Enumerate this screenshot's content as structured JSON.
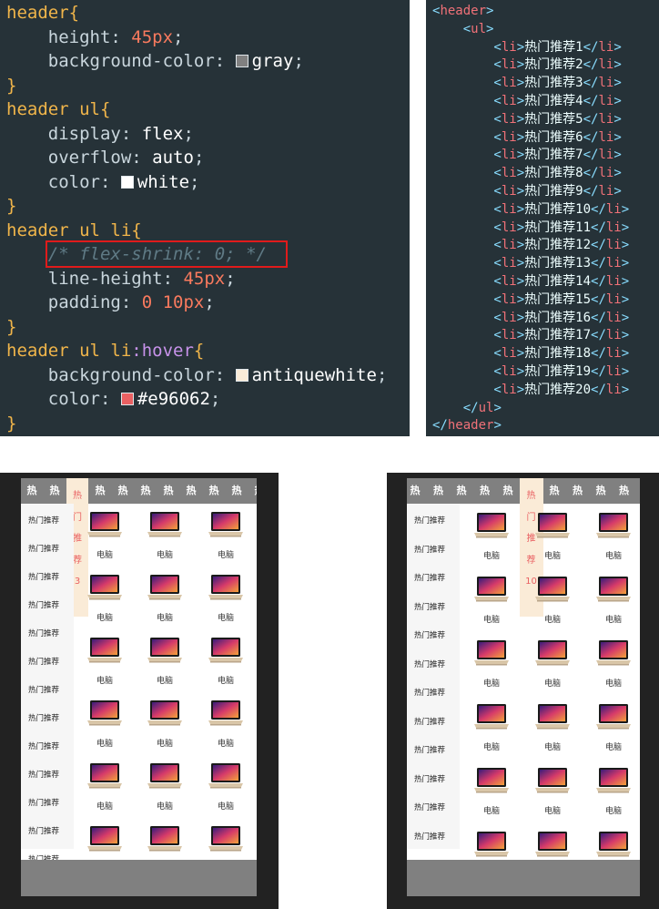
{
  "css_code": {
    "lines": [
      [
        {
          "t": "header",
          "c": "t-sel"
        },
        {
          "t": "{",
          "c": "t-brace"
        }
      ],
      [
        {
          "t": "    height",
          "c": "t-prop"
        },
        {
          "t": ": ",
          "c": "t-punc"
        },
        {
          "t": "45px",
          "c": "t-num"
        },
        {
          "t": ";",
          "c": "t-punc"
        }
      ],
      [
        {
          "t": "    background-color",
          "c": "t-prop"
        },
        {
          "t": ": ",
          "c": "t-punc"
        },
        {
          "sw": "#808080"
        },
        {
          "t": "gray",
          "c": "t-kw"
        },
        {
          "t": ";",
          "c": "t-punc"
        }
      ],
      [
        {
          "t": "}",
          "c": "t-brace"
        }
      ],
      [
        {
          "t": "header ul",
          "c": "t-sel"
        },
        {
          "t": "{",
          "c": "t-brace"
        }
      ],
      [
        {
          "t": "    display",
          "c": "t-prop"
        },
        {
          "t": ": ",
          "c": "t-punc"
        },
        {
          "t": "flex",
          "c": "t-kw"
        },
        {
          "t": ";",
          "c": "t-punc"
        }
      ],
      [
        {
          "t": "    overflow",
          "c": "t-prop"
        },
        {
          "t": ": ",
          "c": "t-punc"
        },
        {
          "t": "auto",
          "c": "t-kw"
        },
        {
          "t": ";",
          "c": "t-punc"
        }
      ],
      [
        {
          "t": "    color",
          "c": "t-prop"
        },
        {
          "t": ": ",
          "c": "t-punc"
        },
        {
          "sw": "#ffffff"
        },
        {
          "t": "white",
          "c": "t-kw"
        },
        {
          "t": ";",
          "c": "t-punc"
        }
      ],
      [
        {
          "t": "}",
          "c": "t-brace"
        }
      ],
      [
        {
          "t": "header ul li",
          "c": "t-sel"
        },
        {
          "t": "{",
          "c": "t-brace"
        }
      ],
      [
        {
          "t": "    ",
          "c": "t-prop"
        },
        {
          "t": "/* flex-shrink: 0; */",
          "c": "t-comment"
        }
      ],
      [
        {
          "t": "    line-height",
          "c": "t-prop"
        },
        {
          "t": ": ",
          "c": "t-punc"
        },
        {
          "t": "45px",
          "c": "t-num"
        },
        {
          "t": ";",
          "c": "t-punc"
        }
      ],
      [
        {
          "t": "    padding",
          "c": "t-prop"
        },
        {
          "t": ": ",
          "c": "t-punc"
        },
        {
          "t": "0 10px",
          "c": "t-num"
        },
        {
          "t": ";",
          "c": "t-punc"
        }
      ],
      [
        {
          "t": "}",
          "c": "t-brace"
        }
      ],
      [
        {
          "t": "header ul li",
          "c": "t-sel"
        },
        {
          "t": ":hover",
          "c": "t-pseudo"
        },
        {
          "t": "{",
          "c": "t-brace"
        }
      ],
      [
        {
          "t": "    background-color",
          "c": "t-prop"
        },
        {
          "t": ": ",
          "c": "t-punc"
        },
        {
          "sw": "#faebd7"
        },
        {
          "t": "antiquewhite",
          "c": "t-kw"
        },
        {
          "t": ";",
          "c": "t-punc"
        }
      ],
      [
        {
          "t": "    color",
          "c": "t-prop"
        },
        {
          "t": ": ",
          "c": "t-punc"
        },
        {
          "sw": "#e96062"
        },
        {
          "t": "#e96062",
          "c": "t-kw"
        },
        {
          "t": ";",
          "c": "t-punc"
        }
      ],
      [
        {
          "t": "}",
          "c": "t-brace"
        }
      ]
    ]
  },
  "html_code": {
    "lines": [
      [
        {
          "t": "<",
          "c": "t-angle"
        },
        {
          "t": "header",
          "c": "t-tag"
        },
        {
          "t": ">",
          "c": "t-angle"
        }
      ],
      [
        {
          "t": "    <",
          "c": "t-angle"
        },
        {
          "t": "ul",
          "c": "t-tag"
        },
        {
          "t": ">",
          "c": "t-angle"
        }
      ],
      [
        {
          "t": "        <",
          "c": "t-angle"
        },
        {
          "t": "li",
          "c": "t-tag"
        },
        {
          "t": ">",
          "c": "t-angle"
        },
        {
          "t": "热门推荐1",
          "c": "t-text"
        },
        {
          "t": "</",
          "c": "t-angle"
        },
        {
          "t": "li",
          "c": "t-tag"
        },
        {
          "t": ">",
          "c": "t-angle"
        }
      ],
      [
        {
          "t": "        <",
          "c": "t-angle"
        },
        {
          "t": "li",
          "c": "t-tag"
        },
        {
          "t": ">",
          "c": "t-angle"
        },
        {
          "t": "热门推荐2",
          "c": "t-text"
        },
        {
          "t": "</",
          "c": "t-angle"
        },
        {
          "t": "li",
          "c": "t-tag"
        },
        {
          "t": ">",
          "c": "t-angle"
        }
      ],
      [
        {
          "t": "        <",
          "c": "t-angle"
        },
        {
          "t": "li",
          "c": "t-tag"
        },
        {
          "t": ">",
          "c": "t-angle"
        },
        {
          "t": "热门推荐3",
          "c": "t-text"
        },
        {
          "t": "</",
          "c": "t-angle"
        },
        {
          "t": "li",
          "c": "t-tag"
        },
        {
          "t": ">",
          "c": "t-angle"
        }
      ],
      [
        {
          "t": "        <",
          "c": "t-angle"
        },
        {
          "t": "li",
          "c": "t-tag"
        },
        {
          "t": ">",
          "c": "t-angle"
        },
        {
          "t": "热门推荐4",
          "c": "t-text"
        },
        {
          "t": "</",
          "c": "t-angle"
        },
        {
          "t": "li",
          "c": "t-tag"
        },
        {
          "t": ">",
          "c": "t-angle"
        }
      ],
      [
        {
          "t": "        <",
          "c": "t-angle"
        },
        {
          "t": "li",
          "c": "t-tag"
        },
        {
          "t": ">",
          "c": "t-angle"
        },
        {
          "t": "热门推荐5",
          "c": "t-text"
        },
        {
          "t": "</",
          "c": "t-angle"
        },
        {
          "t": "li",
          "c": "t-tag"
        },
        {
          "t": ">",
          "c": "t-angle"
        }
      ],
      [
        {
          "t": "        <",
          "c": "t-angle"
        },
        {
          "t": "li",
          "c": "t-tag"
        },
        {
          "t": ">",
          "c": "t-angle"
        },
        {
          "t": "热门推荐6",
          "c": "t-text"
        },
        {
          "t": "</",
          "c": "t-angle"
        },
        {
          "t": "li",
          "c": "t-tag"
        },
        {
          "t": ">",
          "c": "t-angle"
        }
      ],
      [
        {
          "t": "        <",
          "c": "t-angle"
        },
        {
          "t": "li",
          "c": "t-tag"
        },
        {
          "t": ">",
          "c": "t-angle"
        },
        {
          "t": "热门推荐7",
          "c": "t-text"
        },
        {
          "t": "</",
          "c": "t-angle"
        },
        {
          "t": "li",
          "c": "t-tag"
        },
        {
          "t": ">",
          "c": "t-angle"
        }
      ],
      [
        {
          "t": "        <",
          "c": "t-angle"
        },
        {
          "t": "li",
          "c": "t-tag"
        },
        {
          "t": ">",
          "c": "t-angle"
        },
        {
          "t": "热门推荐8",
          "c": "t-text"
        },
        {
          "t": "</",
          "c": "t-angle"
        },
        {
          "t": "li",
          "c": "t-tag"
        },
        {
          "t": ">",
          "c": "t-angle"
        }
      ],
      [
        {
          "t": "        <",
          "c": "t-angle"
        },
        {
          "t": "li",
          "c": "t-tag"
        },
        {
          "t": ">",
          "c": "t-angle"
        },
        {
          "t": "热门推荐9",
          "c": "t-text"
        },
        {
          "t": "</",
          "c": "t-angle"
        },
        {
          "t": "li",
          "c": "t-tag"
        },
        {
          "t": ">",
          "c": "t-angle"
        }
      ],
      [
        {
          "t": "        <",
          "c": "t-angle"
        },
        {
          "t": "li",
          "c": "t-tag"
        },
        {
          "t": ">",
          "c": "t-angle"
        },
        {
          "t": "热门推荐10",
          "c": "t-text"
        },
        {
          "t": "</",
          "c": "t-angle"
        },
        {
          "t": "li",
          "c": "t-tag"
        },
        {
          "t": ">",
          "c": "t-angle"
        }
      ],
      [
        {
          "t": "        <",
          "c": "t-angle"
        },
        {
          "t": "li",
          "c": "t-tag"
        },
        {
          "t": ">",
          "c": "t-angle"
        },
        {
          "t": "热门推荐11",
          "c": "t-text"
        },
        {
          "t": "</",
          "c": "t-angle"
        },
        {
          "t": "li",
          "c": "t-tag"
        },
        {
          "t": ">",
          "c": "t-angle"
        }
      ],
      [
        {
          "t": "        <",
          "c": "t-angle"
        },
        {
          "t": "li",
          "c": "t-tag"
        },
        {
          "t": ">",
          "c": "t-angle"
        },
        {
          "t": "热门推荐12",
          "c": "t-text"
        },
        {
          "t": "</",
          "c": "t-angle"
        },
        {
          "t": "li",
          "c": "t-tag"
        },
        {
          "t": ">",
          "c": "t-angle"
        }
      ],
      [
        {
          "t": "        <",
          "c": "t-angle"
        },
        {
          "t": "li",
          "c": "t-tag"
        },
        {
          "t": ">",
          "c": "t-angle"
        },
        {
          "t": "热门推荐13",
          "c": "t-text"
        },
        {
          "t": "</",
          "c": "t-angle"
        },
        {
          "t": "li",
          "c": "t-tag"
        },
        {
          "t": ">",
          "c": "t-angle"
        }
      ],
      [
        {
          "t": "        <",
          "c": "t-angle"
        },
        {
          "t": "li",
          "c": "t-tag"
        },
        {
          "t": ">",
          "c": "t-angle"
        },
        {
          "t": "热门推荐14",
          "c": "t-text"
        },
        {
          "t": "</",
          "c": "t-angle"
        },
        {
          "t": "li",
          "c": "t-tag"
        },
        {
          "t": ">",
          "c": "t-angle"
        }
      ],
      [
        {
          "t": "        <",
          "c": "t-angle"
        },
        {
          "t": "li",
          "c": "t-tag"
        },
        {
          "t": ">",
          "c": "t-angle"
        },
        {
          "t": "热门推荐15",
          "c": "t-text"
        },
        {
          "t": "</",
          "c": "t-angle"
        },
        {
          "t": "li",
          "c": "t-tag"
        },
        {
          "t": ">",
          "c": "t-angle"
        }
      ],
      [
        {
          "t": "        <",
          "c": "t-angle"
        },
        {
          "t": "li",
          "c": "t-tag"
        },
        {
          "t": ">",
          "c": "t-angle"
        },
        {
          "t": "热门推荐16",
          "c": "t-text"
        },
        {
          "t": "</",
          "c": "t-angle"
        },
        {
          "t": "li",
          "c": "t-tag"
        },
        {
          "t": ">",
          "c": "t-angle"
        }
      ],
      [
        {
          "t": "        <",
          "c": "t-angle"
        },
        {
          "t": "li",
          "c": "t-tag"
        },
        {
          "t": ">",
          "c": "t-angle"
        },
        {
          "t": "热门推荐17",
          "c": "t-text"
        },
        {
          "t": "</",
          "c": "t-angle"
        },
        {
          "t": "li",
          "c": "t-tag"
        },
        {
          "t": ">",
          "c": "t-angle"
        }
      ],
      [
        {
          "t": "        <",
          "c": "t-angle"
        },
        {
          "t": "li",
          "c": "t-tag"
        },
        {
          "t": ">",
          "c": "t-angle"
        },
        {
          "t": "热门推荐18",
          "c": "t-text"
        },
        {
          "t": "</",
          "c": "t-angle"
        },
        {
          "t": "li",
          "c": "t-tag"
        },
        {
          "t": ">",
          "c": "t-angle"
        }
      ],
      [
        {
          "t": "        <",
          "c": "t-angle"
        },
        {
          "t": "li",
          "c": "t-tag"
        },
        {
          "t": ">",
          "c": "t-angle"
        },
        {
          "t": "热门推荐19",
          "c": "t-text"
        },
        {
          "t": "</",
          "c": "t-angle"
        },
        {
          "t": "li",
          "c": "t-tag"
        },
        {
          "t": ">",
          "c": "t-angle"
        }
      ],
      [
        {
          "t": "        <",
          "c": "t-angle"
        },
        {
          "t": "li",
          "c": "t-tag"
        },
        {
          "t": ">",
          "c": "t-angle"
        },
        {
          "t": "热门推荐20",
          "c": "t-text"
        },
        {
          "t": "</",
          "c": "t-angle"
        },
        {
          "t": "li",
          "c": "t-tag"
        },
        {
          "t": ">",
          "c": "t-angle"
        }
      ],
      [
        {
          "t": "    </",
          "c": "t-angle"
        },
        {
          "t": "ul",
          "c": "t-tag"
        },
        {
          "t": ">",
          "c": "t-angle"
        }
      ],
      [
        {
          "t": "</",
          "c": "t-angle"
        },
        {
          "t": "header",
          "c": "t-tag"
        },
        {
          "t": ">",
          "c": "t-angle"
        }
      ]
    ]
  },
  "colors": {
    "editor_bg": "#263238",
    "nav_gray": "#808080",
    "hover_bg": "#faebd7",
    "hover_text": "#e96062",
    "highlight_border": "#e01b1b"
  },
  "preview_a": {
    "nav_items": [
      "热",
      "热",
      "热",
      "热",
      "热",
      "热",
      "热",
      "热",
      "热",
      "热",
      "热"
    ],
    "active_index": 2,
    "active_text": "热门推荐3",
    "side_items": [
      "热门推荐",
      "热门推荐",
      "热门推荐",
      "热门推荐",
      "热门推荐",
      "热门推荐",
      "热门推荐",
      "热门推荐",
      "热门推荐",
      "热门推荐",
      "热门推荐",
      "热门推荐",
      "热门推荐"
    ],
    "product_label": "电脑",
    "product_icon": "laptop-icon"
  },
  "preview_b": {
    "nav_items": [
      "热",
      "热",
      "热",
      "热",
      "热",
      "热",
      "热",
      "热",
      "热",
      "热"
    ],
    "active_index": 5,
    "active_text": "热门推荐10",
    "side_items": [
      "热门推荐",
      "热门推荐",
      "热门推荐",
      "热门推荐",
      "热门推荐",
      "热门推荐",
      "热门推荐",
      "热门推荐",
      "热门推荐",
      "热门推荐",
      "热门推荐",
      "热门推荐",
      "热门推荐"
    ],
    "product_label": "电脑",
    "product_icon": "laptop-icon"
  }
}
